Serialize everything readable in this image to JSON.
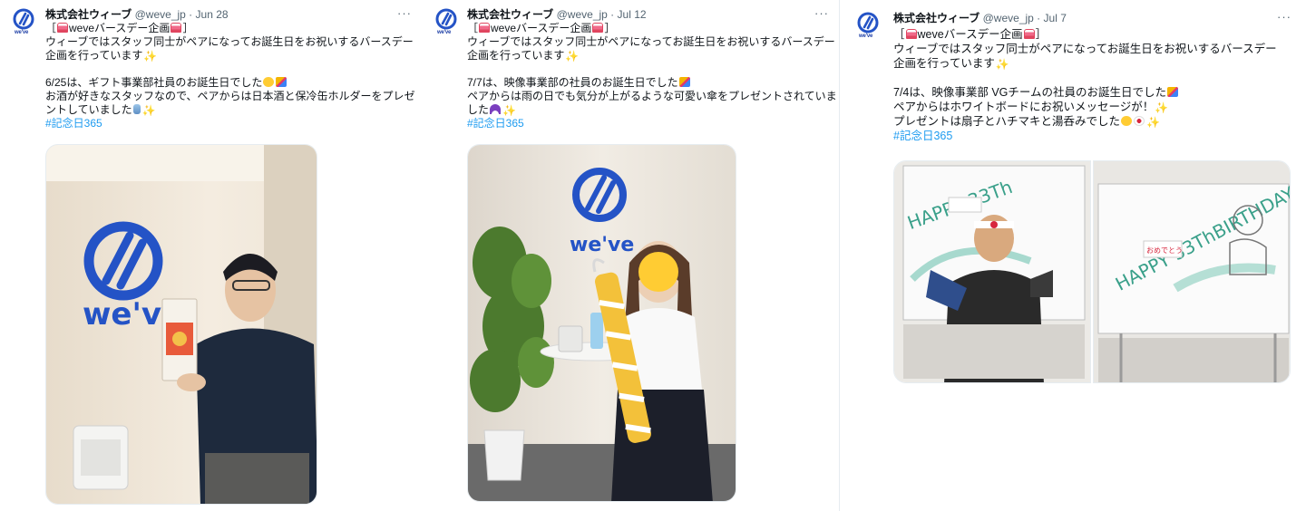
{
  "tweets": [
    {
      "author": "株式会社ウィーブ",
      "handle": "@weve_jp",
      "date": "Jun 28",
      "more": "···",
      "avatar_label": "we've",
      "title_pre": "［",
      "title_text": "weveバースデー企画",
      "title_post": "］",
      "intro_1": "ウィーブではスタッフ同士がペアになってお誕生日をお祝いするバースデー",
      "intro_2": "企画を行っています",
      "detail_1": "6/25は、ギフト事業部社員のお誕生日でした",
      "detail_2": "お酒が好きなスタッフなので、ペアからは日本酒と保冷缶ホルダーをプレゼ",
      "detail_3": "ントしていました",
      "hashtag": "#記念日365",
      "photo_alt": "we've"
    },
    {
      "author": "株式会社ウィーブ",
      "handle": "@weve_jp",
      "date": "Jul 12",
      "more": "···",
      "avatar_label": "we've",
      "title_pre": "［",
      "title_text": "weveバースデー企画",
      "title_post": "］",
      "intro_1": "ウィーブではスタッフ同士がペアになってお誕生日をお祝いするバースデー",
      "intro_2": "企画を行っています",
      "detail_1": "7/7は、映像事業部の社員のお誕生日でした",
      "detail_2": "ペアからは雨の日でも気分が上がるような可愛い傘をプレゼントされていま",
      "detail_3": "した",
      "hashtag": "#記念日365",
      "photo_alt": "we've"
    },
    {
      "author": "株式会社ウィーブ",
      "handle": "@weve_jp",
      "date": "Jul 7",
      "more": "···",
      "avatar_label": "we've",
      "title_pre": "［",
      "title_text": "weveバースデー企画",
      "title_post": "］",
      "intro_1": "ウィーブではスタッフ同士がペアになってお誕生日をお祝いするバースデー",
      "intro_2": "企画を行っています",
      "detail_1": "7/4は、映像事業部 VGチームの社員のお誕生日でした",
      "detail_2": "ペアからはホワイトボードにお祝いメッセージが！",
      "detail_3": "プレゼントは扇子とハチマキと湯呑みでした",
      "hashtag": "#記念日365",
      "board_text": "HAPPY 33ThBIRTHDAY"
    }
  ],
  "colors": {
    "brand_blue": "#2453c6",
    "hashtag": "#1d9bf0",
    "handle_gray": "#536471"
  },
  "icons": [
    "weve-logo-icon",
    "more-icon",
    "cake-emoji",
    "sparkle-emoji",
    "party-popper-emoji",
    "smile-emoji",
    "bottle-emoji",
    "umbrella-emoji",
    "laugh-emoji",
    "japan-flag-emoji"
  ]
}
